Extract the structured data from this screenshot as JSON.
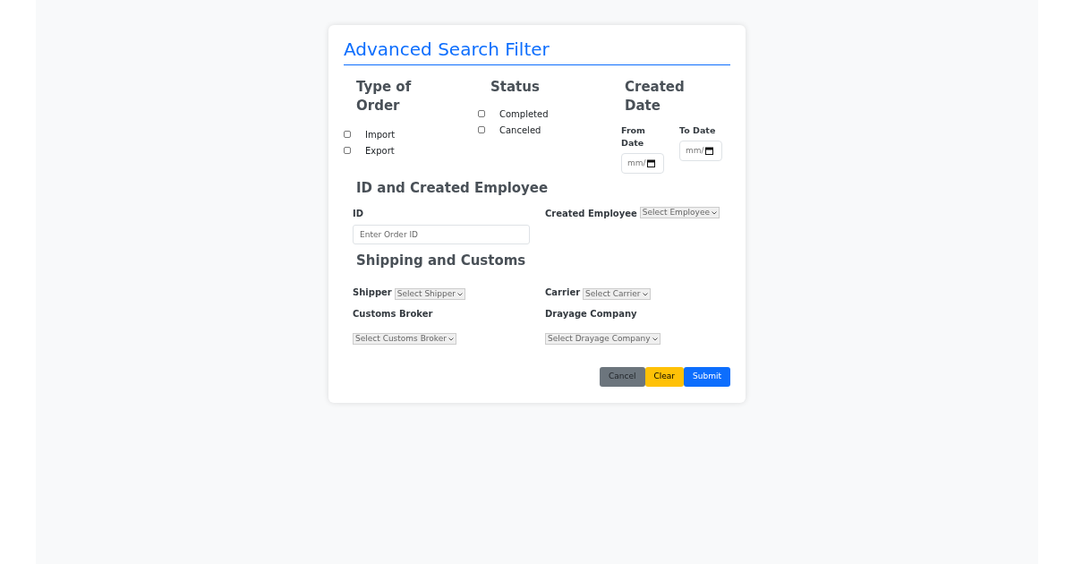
{
  "title": "Advanced Search Filter",
  "groups": [
    {
      "heading": "Type of Order",
      "options": [
        {
          "label": "Import",
          "checked": false
        },
        {
          "label": "Export",
          "checked": false
        }
      ]
    },
    {
      "heading": "Status",
      "options": [
        {
          "label": "Completed",
          "checked": false
        },
        {
          "label": "Canceled",
          "checked": false
        }
      ]
    }
  ],
  "created_date": {
    "heading": "Created Date",
    "fields": [
      {
        "label": "From Date",
        "shown": "mm/"
      },
      {
        "label": "To Date",
        "shown": "mm/"
      }
    ]
  },
  "id_section": {
    "heading": "ID and Created Employee",
    "id_label": "ID",
    "id_placeholder": "Enter Order ID",
    "employee_label": "Created Employee",
    "employee_select": "Select Employee"
  },
  "shipping": {
    "heading": "Shipping and Customs",
    "left": [
      {
        "label": "Shipper",
        "select": "Select Shipper"
      },
      {
        "label": "Customs Broker",
        "select": "Select Customs Broker"
      }
    ],
    "right": [
      {
        "label": "Carrier",
        "select": "Select Carrier"
      },
      {
        "label": "Drayage Company",
        "select": "Select Drayage Company"
      }
    ]
  },
  "buttons": [
    {
      "label": "Cancel",
      "kind": "secondary"
    },
    {
      "label": "Clear",
      "kind": "warning"
    },
    {
      "label": "Submit",
      "kind": "primary"
    }
  ]
}
